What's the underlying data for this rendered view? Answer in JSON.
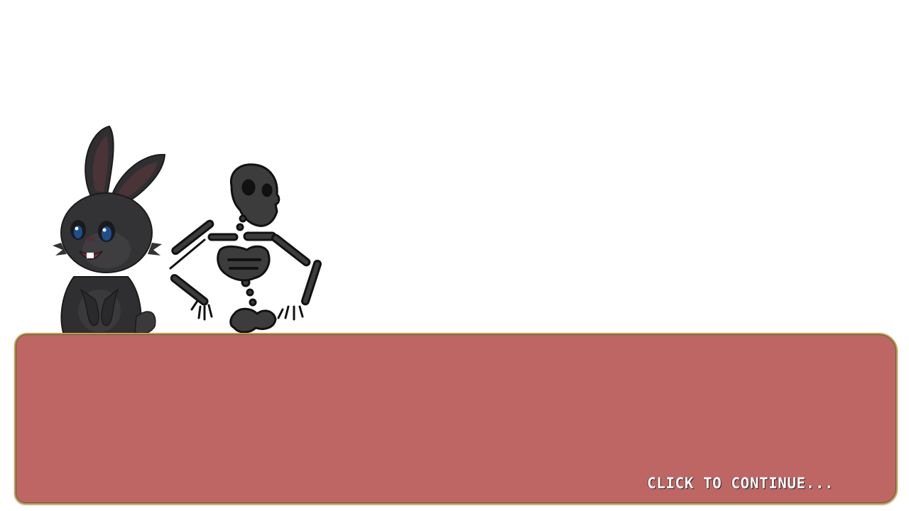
{
  "scene": {
    "characters": [
      {
        "name": "bunny",
        "color": "#2f2f31",
        "ear_inner_color": "#4a3438",
        "eye_color": "#1d4f8f"
      },
      {
        "name": "skeleton",
        "color": "#3c3c3c",
        "outline_color": "#111111"
      }
    ]
  },
  "dialog": {
    "background_color": "#be6664",
    "border_color": "#b8a34a",
    "text": "",
    "continue_label": "CLICK TO CONTINUE..."
  }
}
